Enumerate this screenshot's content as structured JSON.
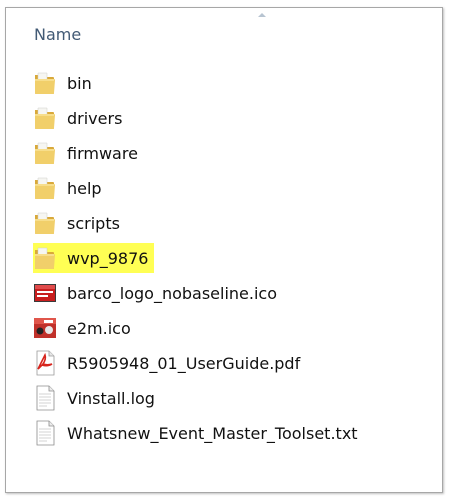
{
  "window": {
    "column_header": "Name",
    "sort": "ascending"
  },
  "files": [
    {
      "name": "bin",
      "type": "folder",
      "icon": "folder-icon",
      "highlighted": false
    },
    {
      "name": "drivers",
      "type": "folder",
      "icon": "folder-icon",
      "highlighted": false
    },
    {
      "name": "firmware",
      "type": "folder",
      "icon": "folder-icon",
      "highlighted": false
    },
    {
      "name": "help",
      "type": "folder",
      "icon": "folder-icon",
      "highlighted": false
    },
    {
      "name": "scripts",
      "type": "folder",
      "icon": "folder-icon",
      "highlighted": false
    },
    {
      "name": "wvp_9876",
      "type": "folder",
      "icon": "folder-icon",
      "highlighted": true
    },
    {
      "name": "barco_logo_nobaseline.ico",
      "type": "ico",
      "icon": "barco-logo-file-icon",
      "highlighted": false
    },
    {
      "name": "e2m.ico",
      "type": "ico",
      "icon": "e2m-ico-file-icon",
      "highlighted": false
    },
    {
      "name": "R5905948_01_UserGuide.pdf",
      "type": "pdf",
      "icon": "pdf-file-icon",
      "highlighted": false
    },
    {
      "name": "Vinstall.log",
      "type": "log",
      "icon": "text-file-icon",
      "highlighted": false
    },
    {
      "name": "Whatsnew_Event_Master_Toolset.txt",
      "type": "txt",
      "icon": "text-file-icon",
      "highlighted": false
    }
  ],
  "colors": {
    "highlight": "#ffff54",
    "header_text": "#425a75",
    "folder": "#e9c35a",
    "pdf_red": "#d7261e",
    "barco_red": "#c81e1e"
  }
}
